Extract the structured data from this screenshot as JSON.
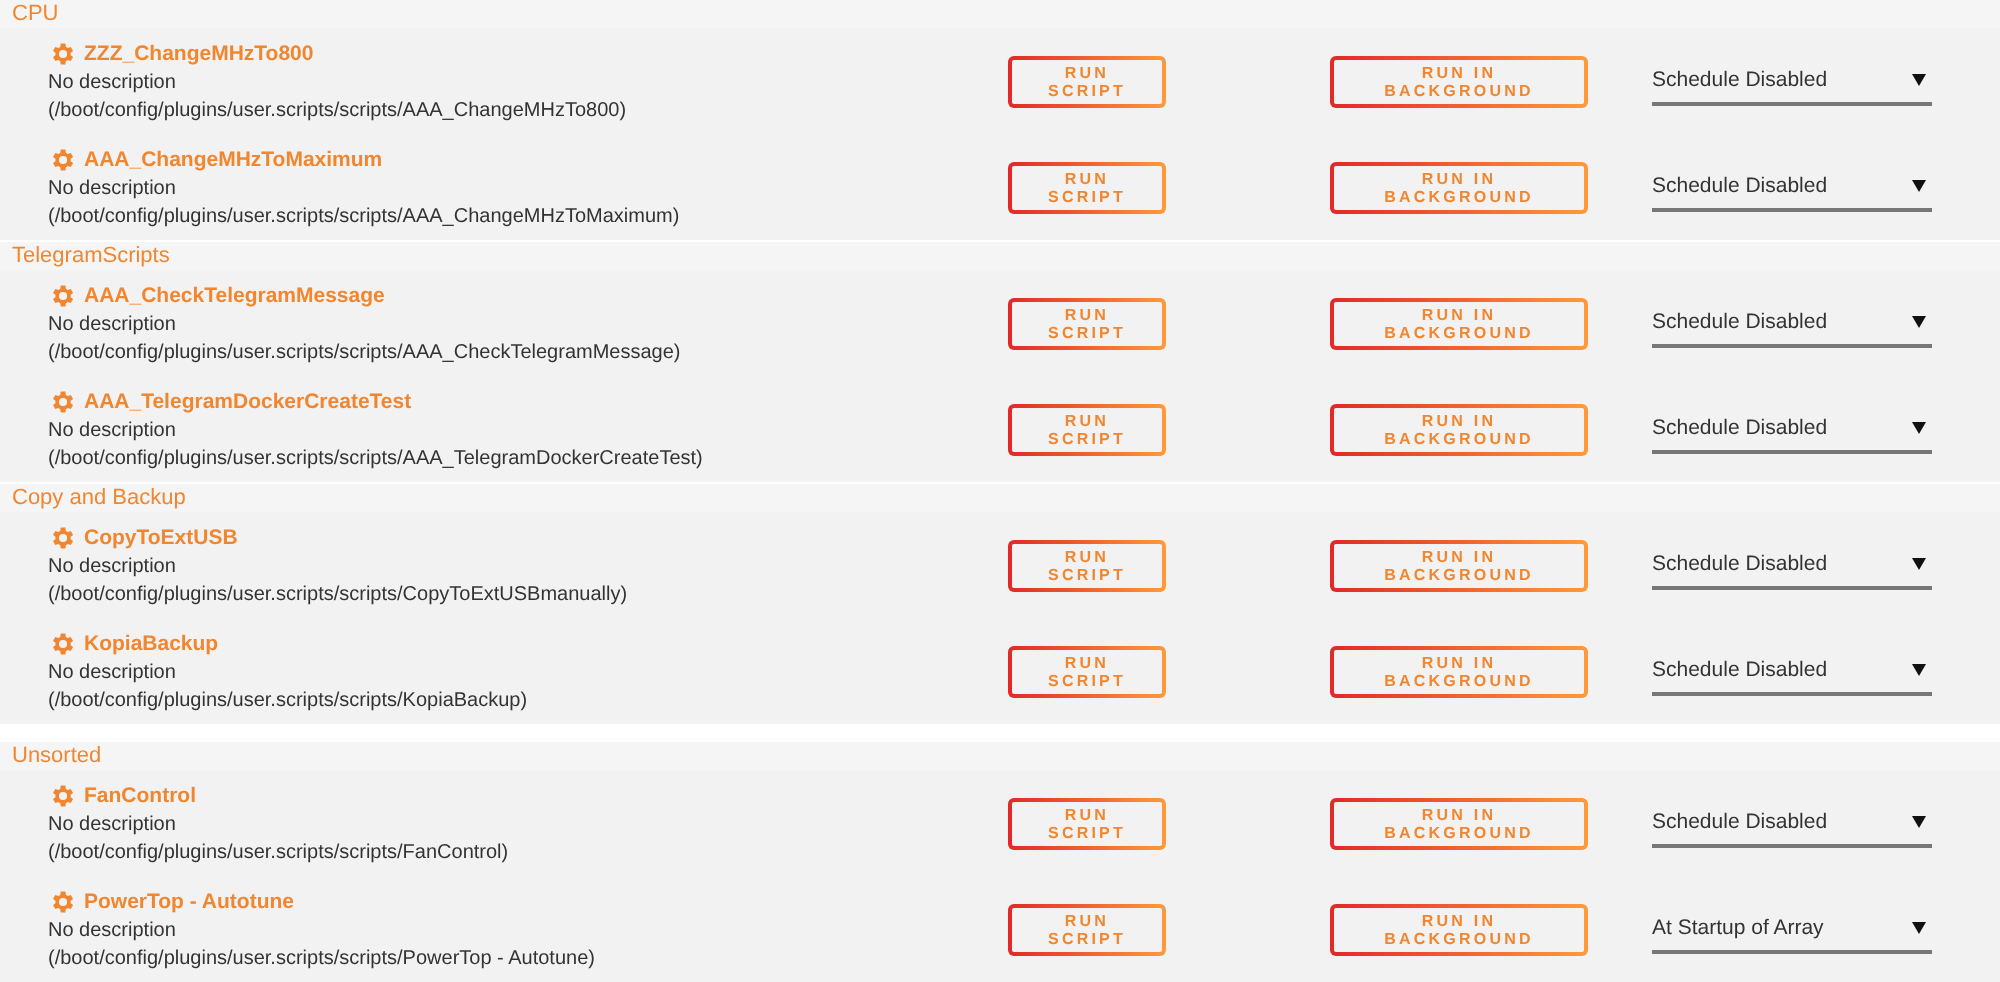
{
  "groups": [
    {
      "title": "CPU",
      "scripts": [
        {
          "name": "ZZZ_ChangeMHzTo800",
          "description": "No description",
          "path": "(/boot/config/plugins/user.scripts/scripts/AAA_ChangeMHzTo800)",
          "run_label": "RUN SCRIPT",
          "background_label": "RUN IN BACKGROUND",
          "schedule": "Schedule Disabled"
        },
        {
          "name": "AAA_ChangeMHzToMaximum",
          "description": "No description",
          "path": "(/boot/config/plugins/user.scripts/scripts/AAA_ChangeMHzToMaximum)",
          "run_label": "RUN SCRIPT",
          "background_label": "RUN IN BACKGROUND",
          "schedule": "Schedule Disabled"
        }
      ]
    },
    {
      "title": "TelegramScripts",
      "scripts": [
        {
          "name": "AAA_CheckTelegramMessage",
          "description": "No description",
          "path": "(/boot/config/plugins/user.scripts/scripts/AAA_CheckTelegramMessage)",
          "run_label": "RUN SCRIPT",
          "background_label": "RUN IN BACKGROUND",
          "schedule": "Schedule Disabled"
        },
        {
          "name": "AAA_TelegramDockerCreateTest",
          "description": "No description",
          "path": "(/boot/config/plugins/user.scripts/scripts/AAA_TelegramDockerCreateTest)",
          "run_label": "RUN SCRIPT",
          "background_label": "RUN IN BACKGROUND",
          "schedule": "Schedule Disabled"
        }
      ]
    },
    {
      "title": "Copy and Backup",
      "scripts": [
        {
          "name": "CopyToExtUSB",
          "description": "No description",
          "path": "(/boot/config/plugins/user.scripts/scripts/CopyToExtUSBmanually)",
          "run_label": "RUN SCRIPT",
          "background_label": "RUN IN BACKGROUND",
          "schedule": "Schedule Disabled"
        },
        {
          "name": "KopiaBackup",
          "description": "No description",
          "path": "(/boot/config/plugins/user.scripts/scripts/KopiaBackup)",
          "run_label": "RUN SCRIPT",
          "background_label": "RUN IN BACKGROUND",
          "schedule": "Schedule Disabled"
        }
      ]
    },
    {
      "title": "Unsorted",
      "scripts": [
        {
          "name": "FanControl",
          "description": "No description",
          "path": "(/boot/config/plugins/user.scripts/scripts/FanControl)",
          "run_label": "RUN SCRIPT",
          "background_label": "RUN IN BACKGROUND",
          "schedule": "Schedule Disabled"
        },
        {
          "name": "PowerTop - Autotune",
          "description": "No description",
          "path": "(/boot/config/plugins/user.scripts/scripts/PowerTop - Autotune)",
          "run_label": "RUN SCRIPT",
          "background_label": "RUN IN BACKGROUND",
          "schedule": "At Startup of Array"
        }
      ]
    }
  ]
}
